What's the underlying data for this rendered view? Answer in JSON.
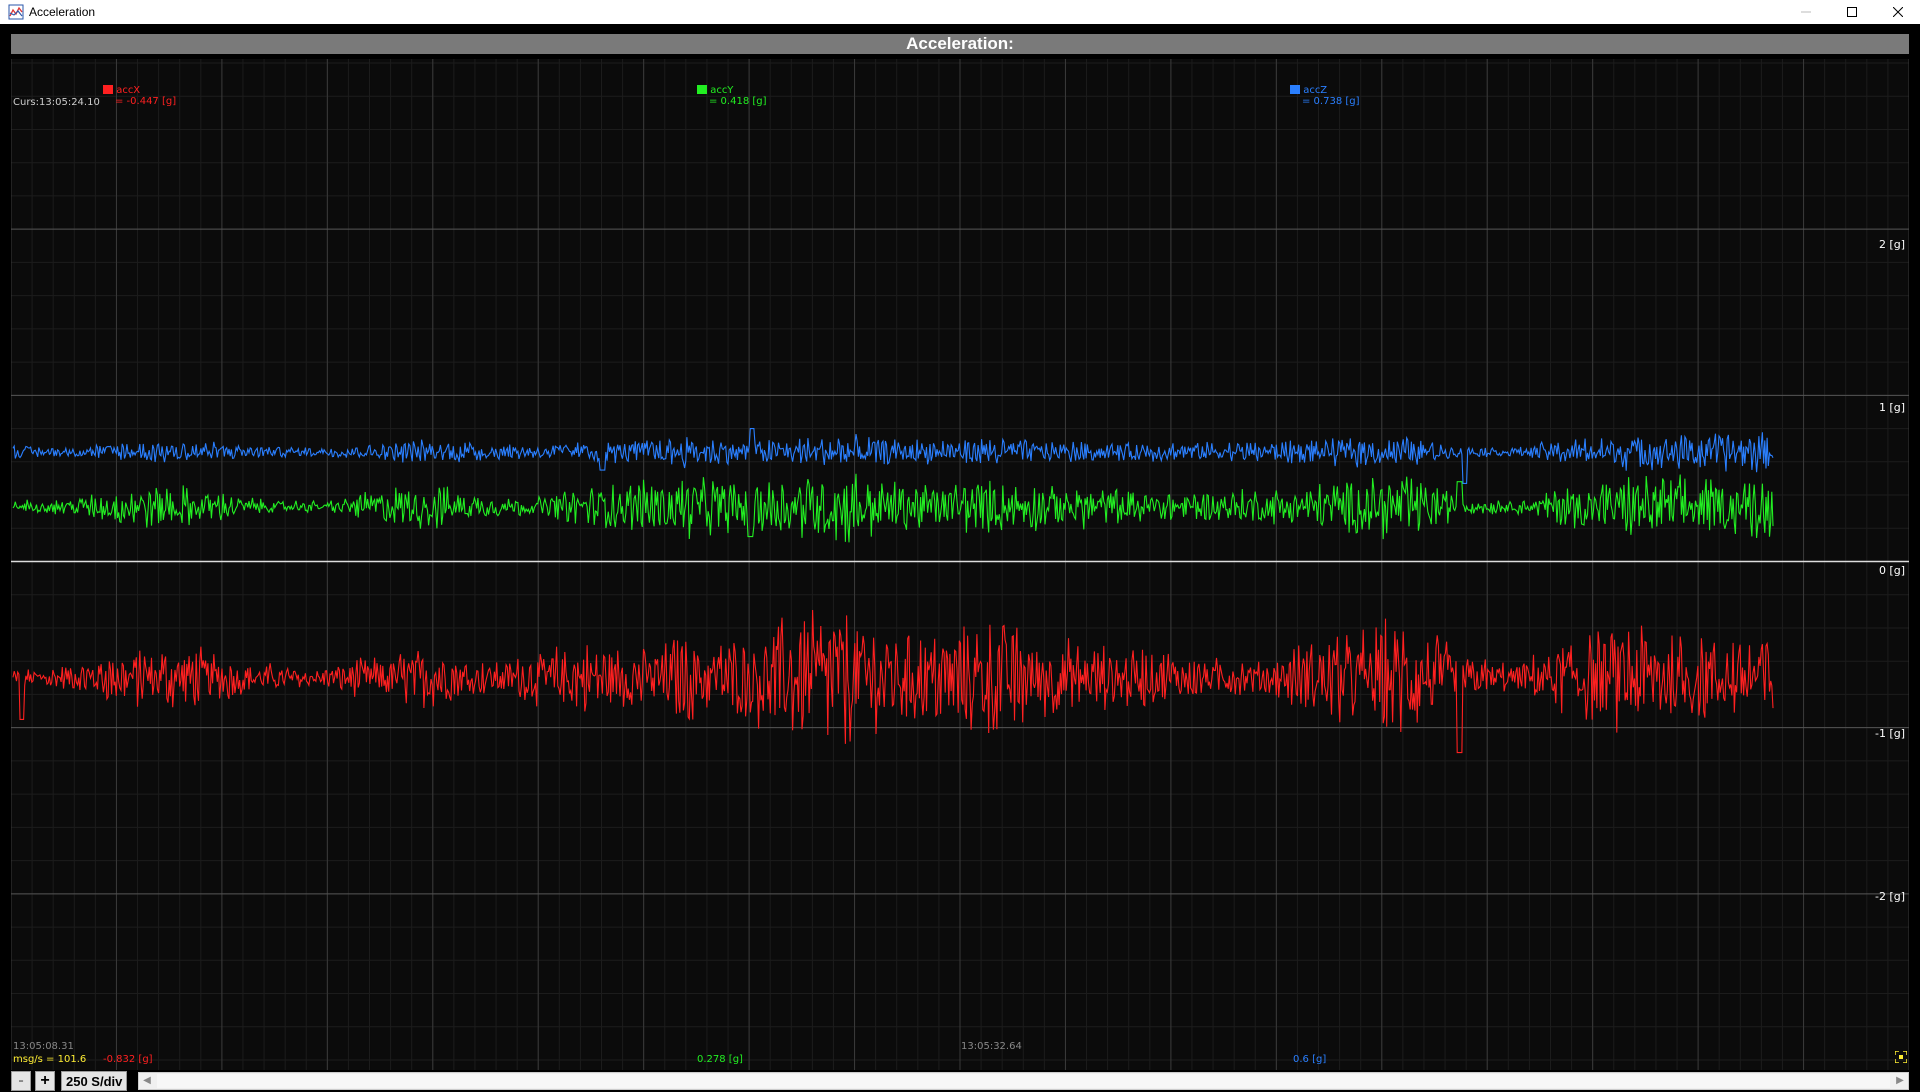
{
  "window": {
    "title": "Acceleration",
    "icon": "chart-app-icon"
  },
  "plot": {
    "header": "Acceleration:",
    "background": "#0b0b0b",
    "cursor_readout": "Curs:13:05:24.10",
    "time_start": "13:05:08.31",
    "time_mid": "13:05:32.64",
    "msg_rate": "msg/s = 101.6",
    "rate_per_div": "250 S/div"
  },
  "legend": [
    {
      "name": "accX",
      "value": "= -0.447 [g]",
      "min": "-0.832 [g]",
      "color": "#ff2020"
    },
    {
      "name": "accY",
      "value": "= 0.418 [g]",
      "min": "0.278 [g]",
      "color": "#22ee22"
    },
    {
      "name": "accZ",
      "value": "= 0.738 [g]",
      "min": "0.6 [g]",
      "color": "#2a7fff"
    }
  ],
  "chart_data": {
    "type": "line",
    "title": "Acceleration:",
    "xlabel": "",
    "ylabel": "",
    "yticks": [
      "2 [g]",
      "1 [g]",
      "0 [g]",
      "-1 [g]",
      "-2 [g]"
    ],
    "ylim": [
      -3,
      3
    ],
    "grid": true,
    "x_start": "13:05:08.31",
    "x_mid": "13:05:32.64",
    "x_divisions": 18,
    "series": [
      {
        "name": "accX",
        "color": "#ff2020",
        "mean": -0.7,
        "amp": 0.08,
        "spikes": [
          [
            0.005,
            -0.95
          ],
          [
            0.822,
            -1.15
          ]
        ],
        "envelope": [
          0.03,
          0.05,
          0.1,
          0.15,
          0.1,
          0.05,
          0.04,
          0.09,
          0.12,
          0.07,
          0.1,
          0.14,
          0.12,
          0.18,
          0.16,
          0.25,
          0.3,
          0.18,
          0.2,
          0.26,
          0.16,
          0.14,
          0.12,
          0.08,
          0.06,
          0.14,
          0.2,
          0.26,
          0.1,
          0.05,
          0.16,
          0.24,
          0.18,
          0.2,
          0.2
        ]
      },
      {
        "name": "accY",
        "color": "#22ee22",
        "mean": 0.33,
        "amp": 0.05,
        "spikes": [
          [
            0.419,
            0.15
          ],
          [
            0.822,
            0.48
          ]
        ],
        "envelope": [
          0.02,
          0.03,
          0.08,
          0.1,
          0.06,
          0.02,
          0.02,
          0.07,
          0.1,
          0.05,
          0.03,
          0.08,
          0.1,
          0.13,
          0.1,
          0.11,
          0.16,
          0.1,
          0.1,
          0.11,
          0.09,
          0.08,
          0.07,
          0.06,
          0.07,
          0.09,
          0.12,
          0.13,
          0.04,
          0.02,
          0.08,
          0.12,
          0.13,
          0.12,
          0.12
        ]
      },
      {
        "name": "accZ",
        "color": "#2a7fff",
        "mean": 0.66,
        "amp": 0.03,
        "spikes": [
          [
            0.335,
            0.55
          ],
          [
            0.825,
            0.47
          ],
          [
            0.42,
            0.8
          ]
        ],
        "envelope": [
          0.03,
          0.02,
          0.04,
          0.05,
          0.04,
          0.02,
          0.02,
          0.03,
          0.05,
          0.04,
          0.03,
          0.04,
          0.05,
          0.06,
          0.05,
          0.05,
          0.07,
          0.05,
          0.05,
          0.06,
          0.04,
          0.04,
          0.04,
          0.04,
          0.04,
          0.05,
          0.06,
          0.06,
          0.02,
          0.02,
          0.05,
          0.07,
          0.08,
          0.08,
          0.08
        ]
      }
    ]
  },
  "controls": {
    "zoom_out": "-",
    "zoom_in": "+",
    "scroll_left": "◀",
    "scroll_right": "▶"
  }
}
